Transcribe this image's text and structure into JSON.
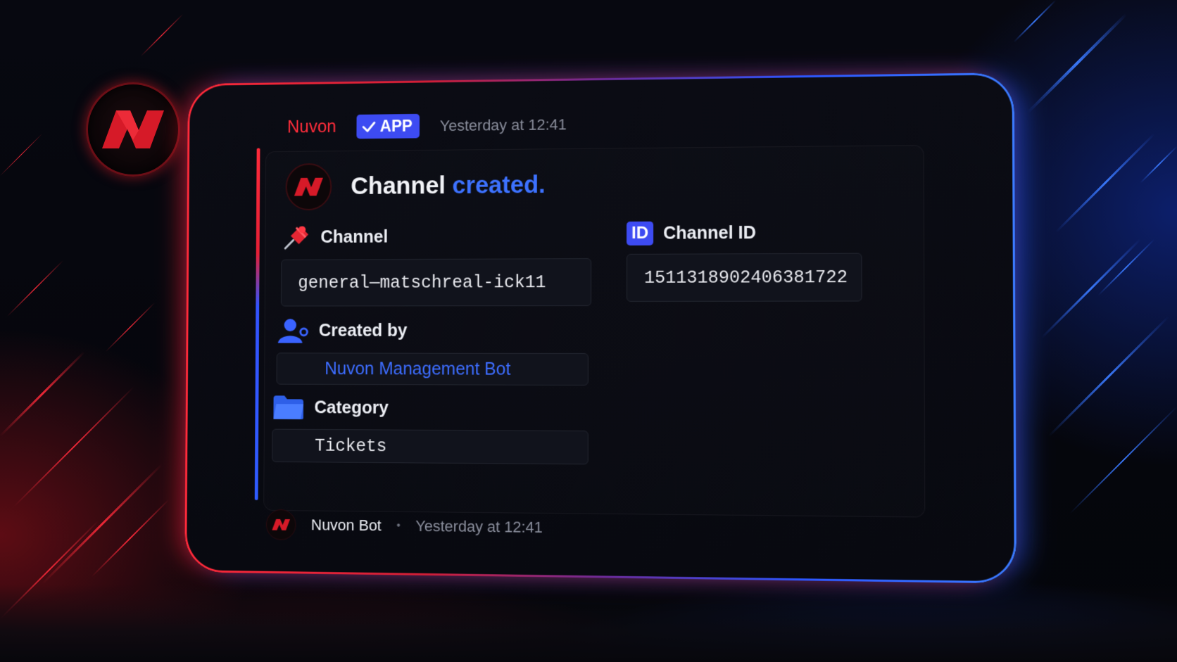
{
  "colors": {
    "accent_red": "#ff2d3b",
    "accent_blue": "#3d6dff",
    "badge_blue": "#3d4bf2",
    "card_bg": "#0b0c14"
  },
  "message": {
    "author": "Nuvon",
    "badge": {
      "icon": "checkmark-icon",
      "label": "APP"
    },
    "timestamp": "Yesterday at 12:41"
  },
  "embed": {
    "avatar_icon": "nuvon-logo-icon",
    "title_main": "Channel",
    "title_accent": "created.",
    "fields": {
      "channel": {
        "icon": "pushpin-icon",
        "label": "Channel",
        "value": "general—matschreal-ick11"
      },
      "channel_id": {
        "icon": "id-badge-icon",
        "icon_text": "ID",
        "label": "Channel ID",
        "value": "1511318902406381722"
      },
      "created_by": {
        "icon": "user-gear-icon",
        "label": "Created by",
        "value": "Nuvon Management Bot"
      },
      "category": {
        "icon": "folder-icon",
        "label": "Category",
        "value": "Tickets"
      }
    },
    "footer": {
      "name": "Nuvon Bot",
      "separator": "•",
      "timestamp": "Yesterday at 12:41"
    }
  }
}
